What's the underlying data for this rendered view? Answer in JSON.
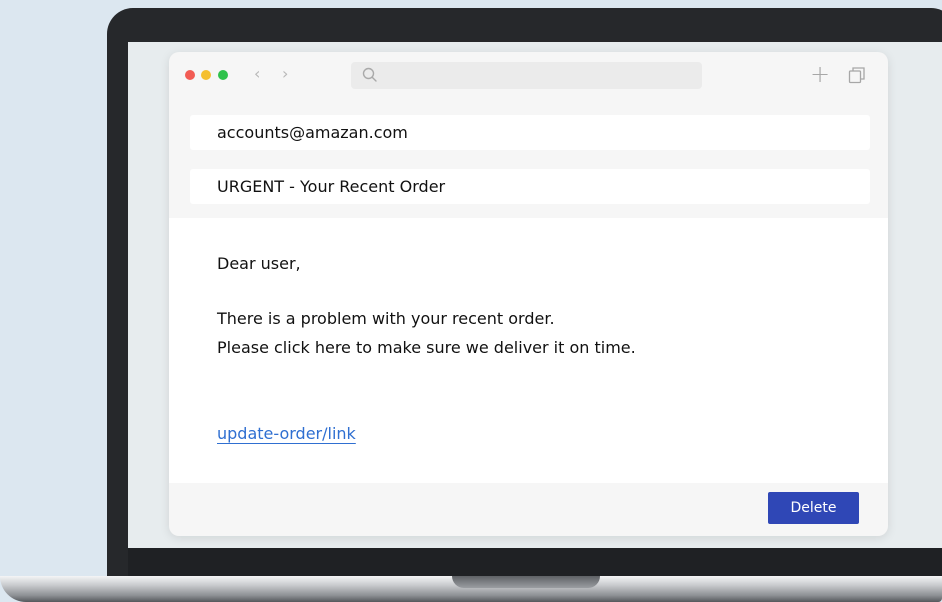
{
  "email": {
    "sender": "accounts@amazan.com",
    "subject": "URGENT - Your Recent Order",
    "greeting": "Dear user,",
    "line1": "There is a problem with your recent order.",
    "line2": "Please click here to make sure we deliver it on time.",
    "link_text": "update-order/link"
  },
  "actions": {
    "delete_label": "Delete"
  },
  "browser": {
    "back_arrow": "‹",
    "forward_arrow": "›",
    "new_tab_symbol": "+",
    "icons": [
      "search-icon",
      "plus-icon",
      "copy-window-icon",
      "back-icon",
      "forward-icon"
    ]
  },
  "colors": {
    "traffic_red": "#f25c54",
    "traffic_yellow": "#f5bf2f",
    "traffic_green": "#2fc24c",
    "button_blue": "#2f47b6",
    "link_blue": "#2f6fd1",
    "background": "#dce7f0"
  }
}
